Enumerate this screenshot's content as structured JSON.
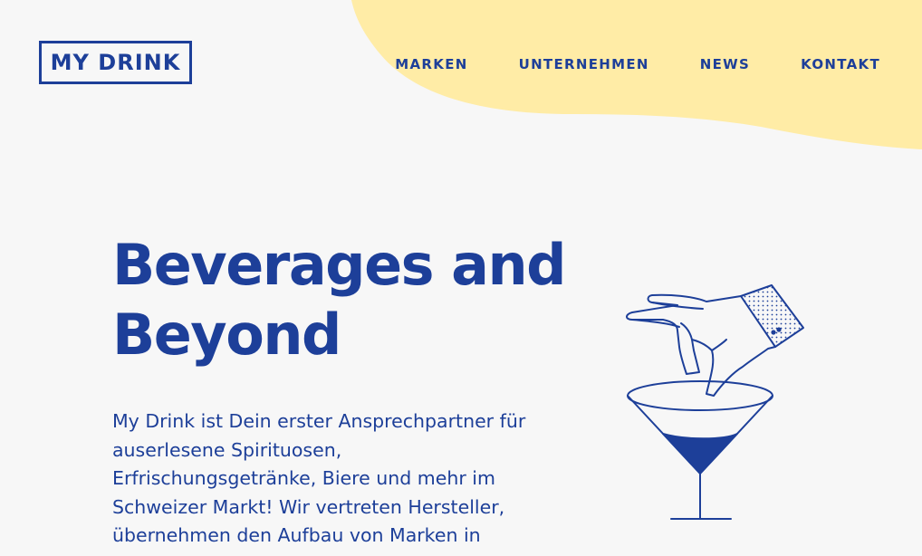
{
  "brand": {
    "logo_text": "MY DRINK"
  },
  "nav": {
    "items": [
      {
        "label": "MARKEN"
      },
      {
        "label": "UNTERNEHMEN"
      },
      {
        "label": "NEWS"
      },
      {
        "label": "KONTAKT"
      }
    ]
  },
  "hero": {
    "title_line1": "Beverages and",
    "title_line2": "Beyond",
    "text": "My Drink ist Dein erster Ansprechpartner für auserlesene Spirituosen, Erfrischungsgetränke, Biere und mehr im Schweizer Markt! Wir vertreten Hersteller, übernehmen den Aufbau von Marken in"
  },
  "colors": {
    "primary": "#1d3f99",
    "background": "#f7f7f7",
    "accent_yellow": "#ffeca6"
  },
  "illustration": {
    "icon": "cocktail-hand-icon"
  }
}
